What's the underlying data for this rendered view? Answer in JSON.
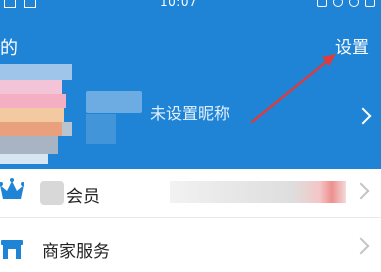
{
  "status_bar": {
    "time": "10:07"
  },
  "header": {
    "title": "的",
    "settings_label": "设置",
    "nickname": "未设置昵称"
  },
  "menu": {
    "items": [
      {
        "label": "会员",
        "icon": "crown-icon"
      },
      {
        "label": "商家服务",
        "icon": "shop-icon"
      }
    ]
  },
  "colors": {
    "header_bg": "#1f83d6",
    "annotation_arrow": "#e03a3a",
    "crown_icon": "#1f83d6"
  }
}
